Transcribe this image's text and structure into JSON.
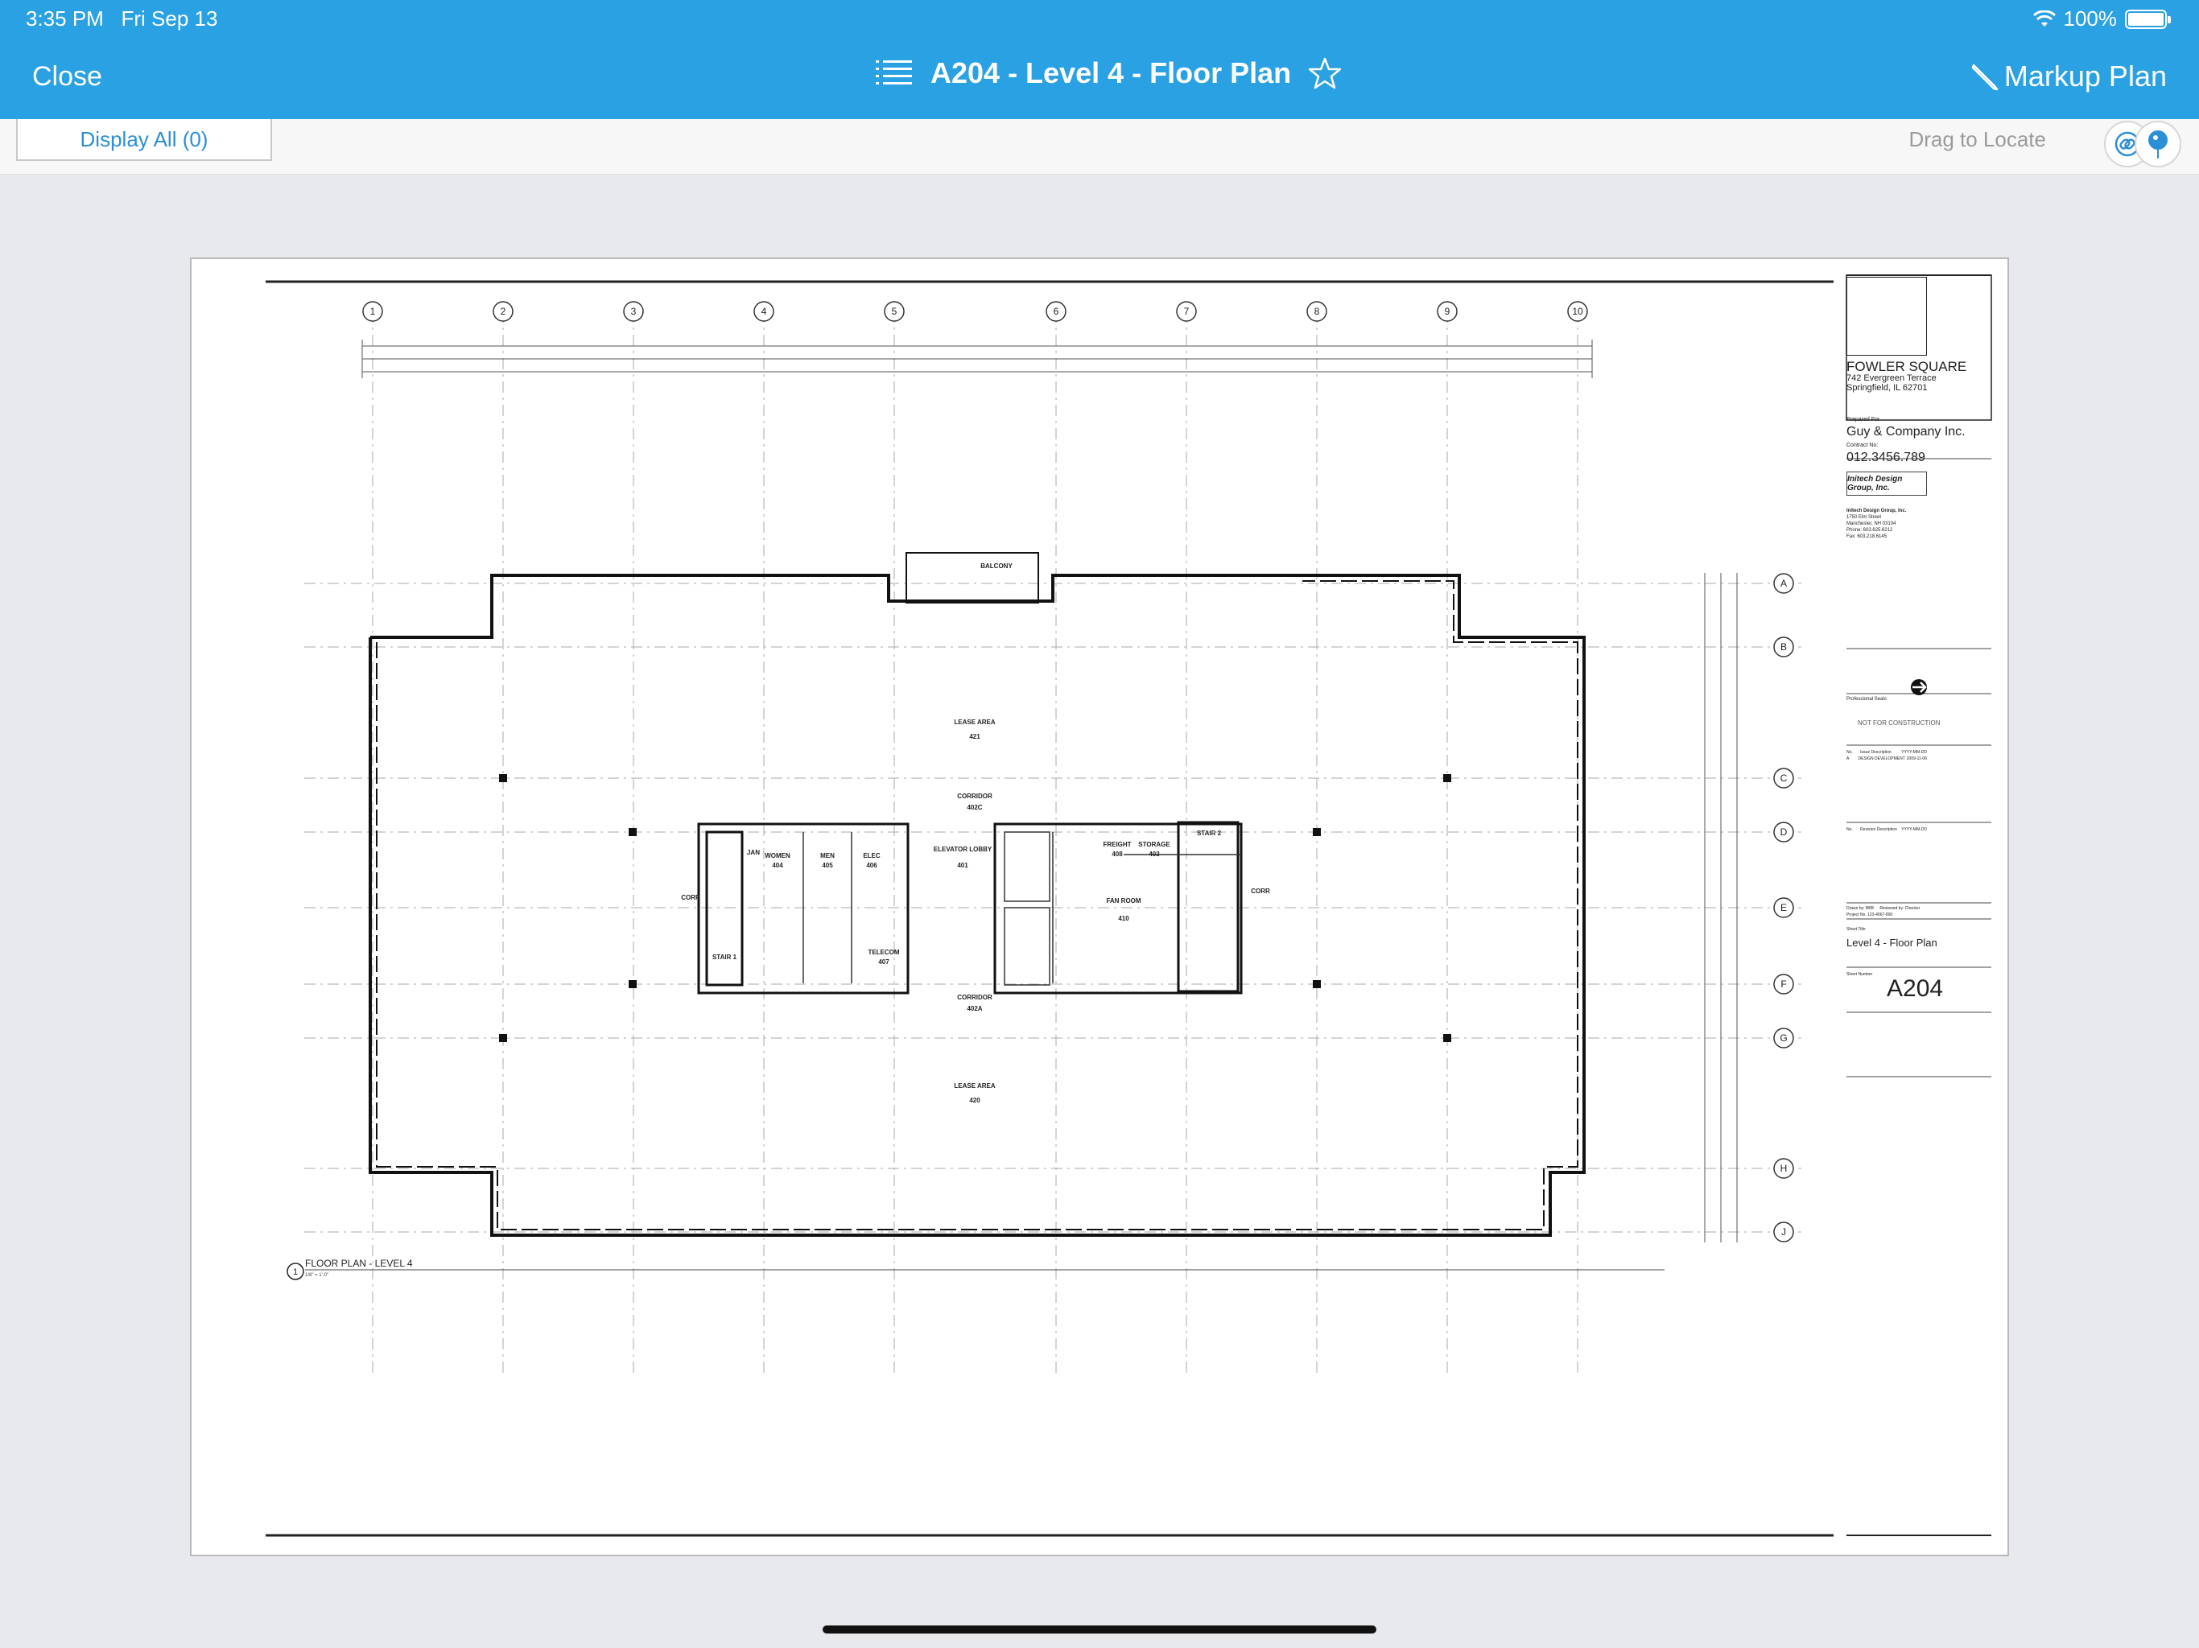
{
  "status": {
    "time": "3:35 PM",
    "date": "Fri Sep 13",
    "battery": "100%"
  },
  "nav": {
    "close": "Close",
    "title": "A204 - Level 4 - Floor Plan",
    "markup": "Markup Plan"
  },
  "toolbar": {
    "display_all": "Display All (0)",
    "drag_to_locate": "Drag to Locate"
  },
  "plan": {
    "grid_numbers": [
      "1",
      "2",
      "3",
      "4",
      "5",
      "6",
      "7",
      "8",
      "9",
      "10"
    ],
    "grid_letters": [
      "A",
      "B",
      "C",
      "D",
      "E",
      "F",
      "G",
      "H",
      "J"
    ],
    "rooms": {
      "balcony": "BALCONY",
      "lease_area_top": "LEASE AREA",
      "lease_area_top_num": "421",
      "lease_area_bottom": "LEASE AREA",
      "lease_area_bottom_num": "420",
      "corridor_top": "CORRIDOR",
      "corridor_top_num": "402C",
      "corridor_bottom": "CORRIDOR",
      "corridor_bottom_num": "402A",
      "women": "WOMEN",
      "women_num": "404",
      "men": "MEN",
      "men_num": "405",
      "elec": "ELEC",
      "elec_num": "406",
      "elevator_lobby": "ELEVATOR LOBBY",
      "elevator_lobby_num": "401",
      "freight": "FREIGHT",
      "freight_num": "408",
      "storage": "STORAGE",
      "storage_num": "403",
      "fan_room": "FAN ROOM",
      "fan_room_num": "410",
      "stair2": "STAIR 2",
      "stair1": "STAIR 1",
      "telecom": "TELECOM",
      "telecom_num": "407",
      "corr_left": "CORR",
      "corr_right": "CORR",
      "jan": "JAN"
    },
    "drawing_title": "FLOOR PLAN - LEVEL 4",
    "drawing_scale": "1/8\" = 1'-0\"",
    "drawing_num": "1"
  },
  "titleblock": {
    "project": "FOWLER SQUARE",
    "address1": "742 Evergreen Terrace",
    "address2": "Springfield, IL 62701",
    "prepared_for_label": "Prepared For",
    "client": "Guy & Company Inc.",
    "contract_label": "Contract No:",
    "contract": "012.3456.789",
    "firm_logo": "Initech Design Group, Inc.",
    "firm_name": "Initech Design Group, Inc.",
    "firm_addr1": "1750 Elm Street",
    "firm_addr2": "Manchester, NH 03104",
    "firm_phone": "Phone: 603.625.6212",
    "firm_fax": "Fax: 603.218.6145",
    "not_for_construction": "NOT FOR CONSTRUCTION",
    "professional_seal": "Professional Seals",
    "issue_header_no": "No.",
    "issue_header_desc": "Issue Description",
    "issue_header_date": "YYYY-MM-DD",
    "issue_row_no": "A",
    "issue_row_desc": "DESIGN DEVELOPMENT",
    "issue_row_date": "2009-11-06",
    "revision_header_no": "No.",
    "revision_header_desc": "Revision Description",
    "revision_header_date": "YYYY-MM-DD",
    "drawn_by_label": "Drawn by:",
    "drawn_by": "BBB",
    "reviewed_by_label": "Reviewed by:",
    "reviewed_by": "Checker",
    "project_no_label": "Project No.",
    "project_no": "123-4567-890",
    "sheet_title_label": "Sheet Title",
    "sheet_title": "Level 4 - Floor Plan",
    "sheet_number_label": "Sheet Number",
    "sheet_number": "A204"
  },
  "colors": {
    "accent": "#29a1e2",
    "link": "#2a8fd6"
  }
}
